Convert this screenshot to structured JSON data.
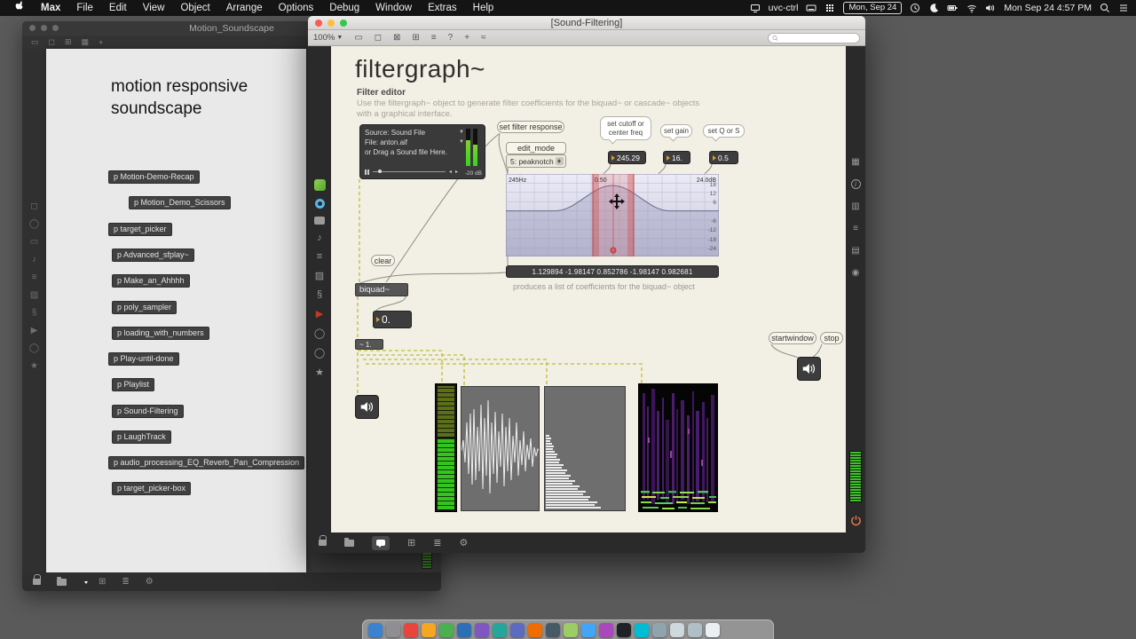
{
  "menubar": {
    "items": [
      "Max",
      "File",
      "Edit",
      "View",
      "Object",
      "Arrange",
      "Options",
      "Debug",
      "Window",
      "Extras",
      "Help"
    ],
    "uvc_label": "uvc-ctrl",
    "date_badge": "Mon, Sep 24",
    "clock_text": "Mon Sep 24  4:57 PM"
  },
  "bg_window": {
    "title": "Motion_Soundscape",
    "heading1": "motion responsive",
    "heading2": "soundscape",
    "patches": [
      "p Motion-Demo-Recap",
      "p Motion_Demo_Scissors",
      "p target_picker",
      "p Advanced_sfplay~",
      "p Make_an_Ahhhh",
      "p poly_sampler",
      "p loading_with_numbers",
      "p Play-until-done",
      "p Playlist",
      "p Sound-Filtering",
      "p LaughTrack",
      "p audio_processing_EQ_Reverb_Pan_Compression",
      "p target_picker-box"
    ]
  },
  "fg_window": {
    "title": "[Sound-Filtering]",
    "zoom": "100%",
    "canvas": {
      "title": "filtergraph~",
      "subtitle": "Filter editor",
      "desc1": "Use the filtergraph~ object to generate filter coefficients for the biquad~ or cascade~ objects",
      "desc2": "with a graphical interface.",
      "sound_panel": {
        "source": "Source: Sound File",
        "file": "File:  anton.aif",
        "drag_hint": "or Drag a Sound file Here.",
        "db_label": "-20 dB"
      },
      "msg_set_filter": "set filter response",
      "bubble_cutoff": "set cutoff or center freq",
      "bubble_gain": "set gain",
      "bubble_q": "set Q or S",
      "msg_edit_mode": "edit_mode",
      "dropdown_mode": "5: peaknotch",
      "num_freq": "245.29",
      "num_gain": "16.",
      "num_q": "0.5",
      "graph": {
        "freq_label": "245Hz",
        "q_label": "0.50",
        "gain_label": "24.0dB",
        "db_ticks": [
          "18",
          "12",
          "6",
          "-6",
          "-12",
          "-18",
          "-24"
        ]
      },
      "coeffs": "1.129894 -1.98147 0.852786 -1.98147 0.982681",
      "coeffs_caption": "produces a list of coefficients for the biquad~ object",
      "msg_clear": "clear",
      "obj_biquad": "biquad~",
      "num_out": "0.",
      "sig_box": "~ 1.",
      "msg_startwindow": "startwindow",
      "msg_stop": "stop"
    }
  }
}
